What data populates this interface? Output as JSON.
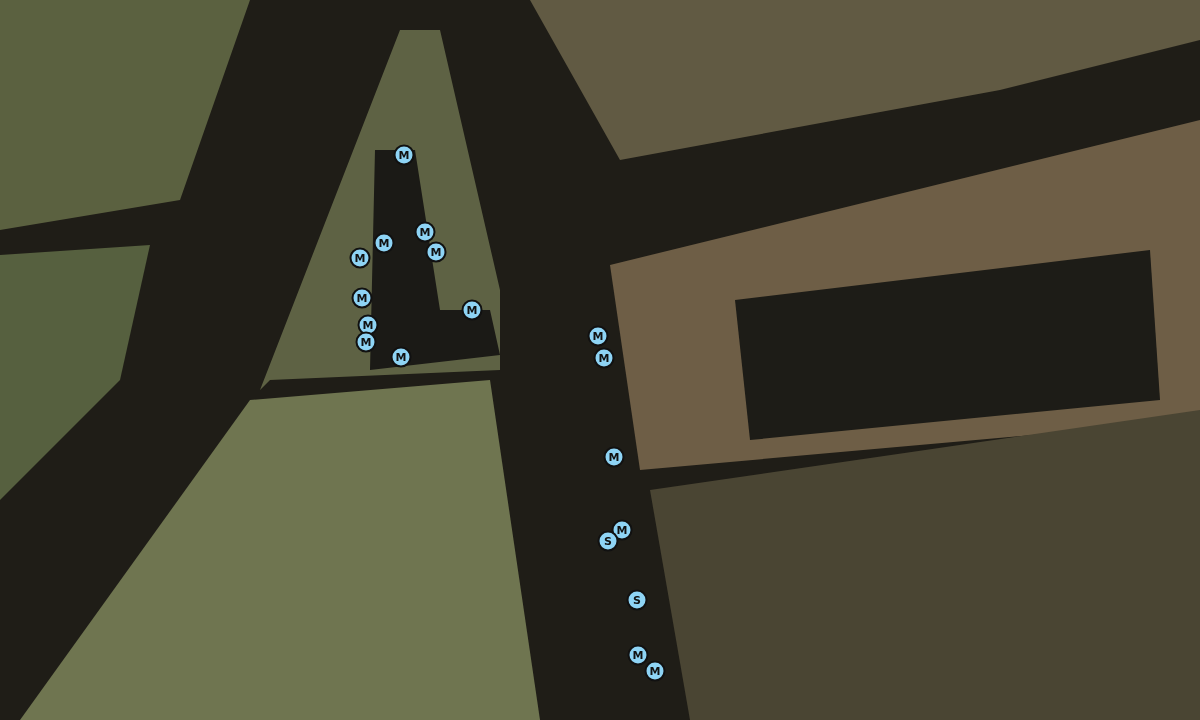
{
  "map": {
    "pins": [
      {
        "label": "M"
      },
      {
        "label": "M"
      },
      {
        "label": "M"
      },
      {
        "label": "M"
      },
      {
        "label": "M"
      },
      {
        "label": "M"
      },
      {
        "label": "M"
      },
      {
        "label": "M"
      },
      {
        "label": "M"
      },
      {
        "label": "M"
      },
      {
        "label": "M"
      },
      {
        "label": "M"
      },
      {
        "label": "M"
      },
      {
        "label": "M"
      },
      {
        "label": "S"
      },
      {
        "label": "S"
      },
      {
        "label": "M"
      },
      {
        "label": "M"
      }
    ]
  }
}
